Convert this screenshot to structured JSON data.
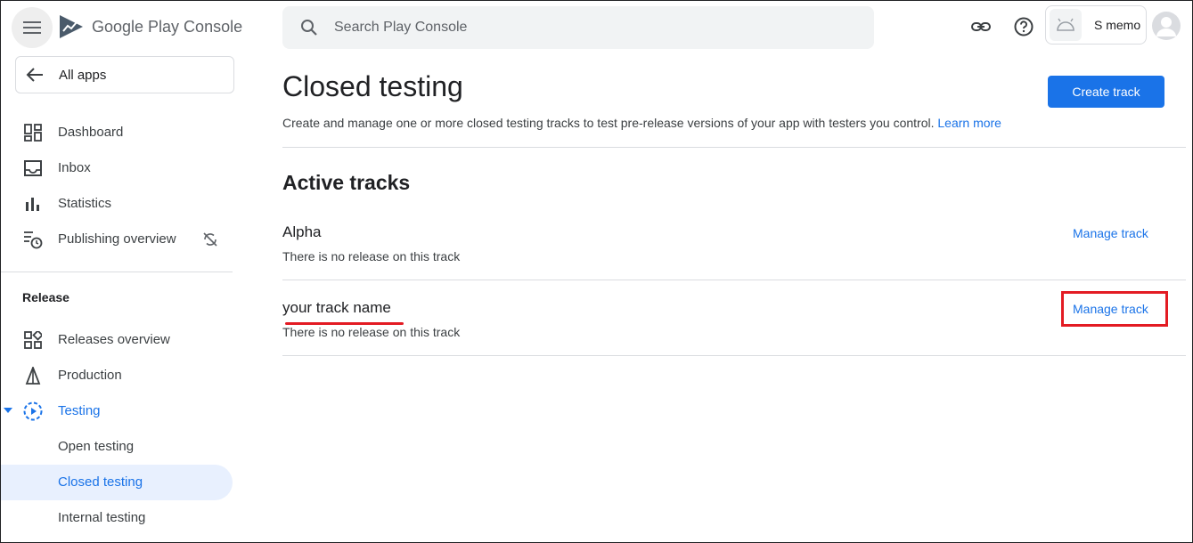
{
  "app": {
    "logo_text": "Google Play Console",
    "colors": {
      "accent": "#1a73e8",
      "highlight": "#e31b23",
      "active_bg": "#e8f0fe"
    }
  },
  "header": {
    "search_placeholder": "Search Play Console",
    "account_name": "S memo",
    "icons": [
      "menu-icon",
      "search-icon",
      "link-icon",
      "help-icon",
      "android-icon",
      "avatar-icon"
    ]
  },
  "sidebar": {
    "back_label": "All apps",
    "items": [
      {
        "label": "Dashboard",
        "icon": "dashboard-icon"
      },
      {
        "label": "Inbox",
        "icon": "inbox-icon"
      },
      {
        "label": "Statistics",
        "icon": "statistics-icon"
      },
      {
        "label": "Publishing overview",
        "icon": "publishing-icon"
      }
    ],
    "release_section": "Release",
    "release_items": [
      {
        "label": "Releases overview",
        "icon": "releases-overview-icon"
      },
      {
        "label": "Production",
        "icon": "production-icon"
      },
      {
        "label": "Testing",
        "icon": "testing-icon"
      }
    ],
    "testing_sub": [
      {
        "label": "Open testing"
      },
      {
        "label": "Closed testing"
      },
      {
        "label": "Internal testing"
      }
    ]
  },
  "main": {
    "title": "Closed testing",
    "create_button": "Create track",
    "description": "Create and manage one or more closed testing tracks to test pre-release versions of your app with testers you control.",
    "learn_more": "Learn more",
    "section_title": "Active tracks",
    "tracks": [
      {
        "name": "Alpha",
        "status": "There is no release on this track",
        "action": "Manage track"
      },
      {
        "name": "your track name",
        "status": "There is no release on this track",
        "action": "Manage track"
      }
    ]
  }
}
